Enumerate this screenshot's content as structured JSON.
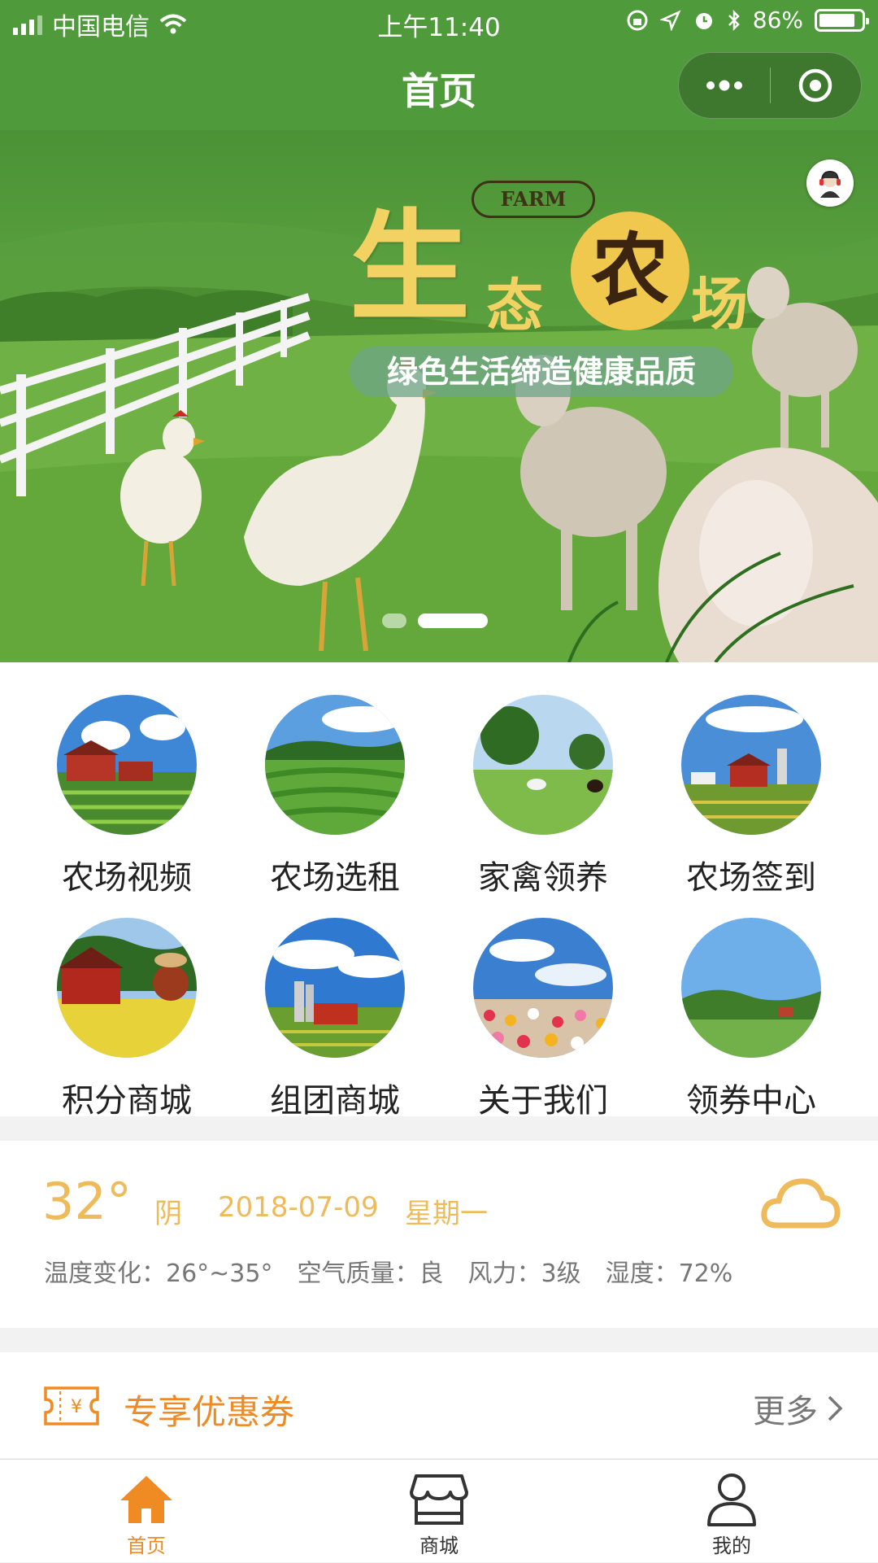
{
  "status_bar": {
    "carrier": "中国电信",
    "time": "上午11:40",
    "battery": "86%",
    "battery_level": 0.86
  },
  "nav": {
    "title": "首页"
  },
  "banner": {
    "badge": "FARM",
    "title_chars": [
      "生",
      "态",
      "农",
      "场"
    ],
    "slogan": "绿色生活缔造健康品质",
    "slide_count": 2,
    "active_slide": 1
  },
  "grid": {
    "items": [
      {
        "label": "农场视频",
        "icon": "farm-video-photo"
      },
      {
        "label": "农场选租",
        "icon": "farm-rent-photo"
      },
      {
        "label": "家禽领养",
        "icon": "poultry-adopt-photo"
      },
      {
        "label": "农场签到",
        "icon": "farm-checkin-photo"
      },
      {
        "label": "积分商城",
        "icon": "points-mall-photo"
      },
      {
        "label": "组团商城",
        "icon": "group-mall-photo"
      },
      {
        "label": "关于我们",
        "icon": "about-us-photo"
      },
      {
        "label": "领券中心",
        "icon": "coupon-center-photo"
      }
    ]
  },
  "weather": {
    "temperature": "32°",
    "condition": "阴",
    "date": "2018-07-09",
    "weekday": "星期一",
    "range": "温度变化：26°~35°",
    "air_quality": "空气质量：良",
    "wind": "风力：3级",
    "humidity": "湿度：72%",
    "icon": "cloud-icon"
  },
  "coupon": {
    "title": "专享优惠券",
    "more": "更多"
  },
  "tabbar": {
    "tabs": [
      {
        "label": "首页",
        "icon": "home-icon",
        "active": true
      },
      {
        "label": "商城",
        "icon": "shop-icon",
        "active": false
      },
      {
        "label": "我的",
        "icon": "user-icon",
        "active": false
      }
    ]
  },
  "colors": {
    "header_green": "#4f9a3b",
    "accent_orange": "#f08a22",
    "weather_yellow": "#efba5a"
  }
}
